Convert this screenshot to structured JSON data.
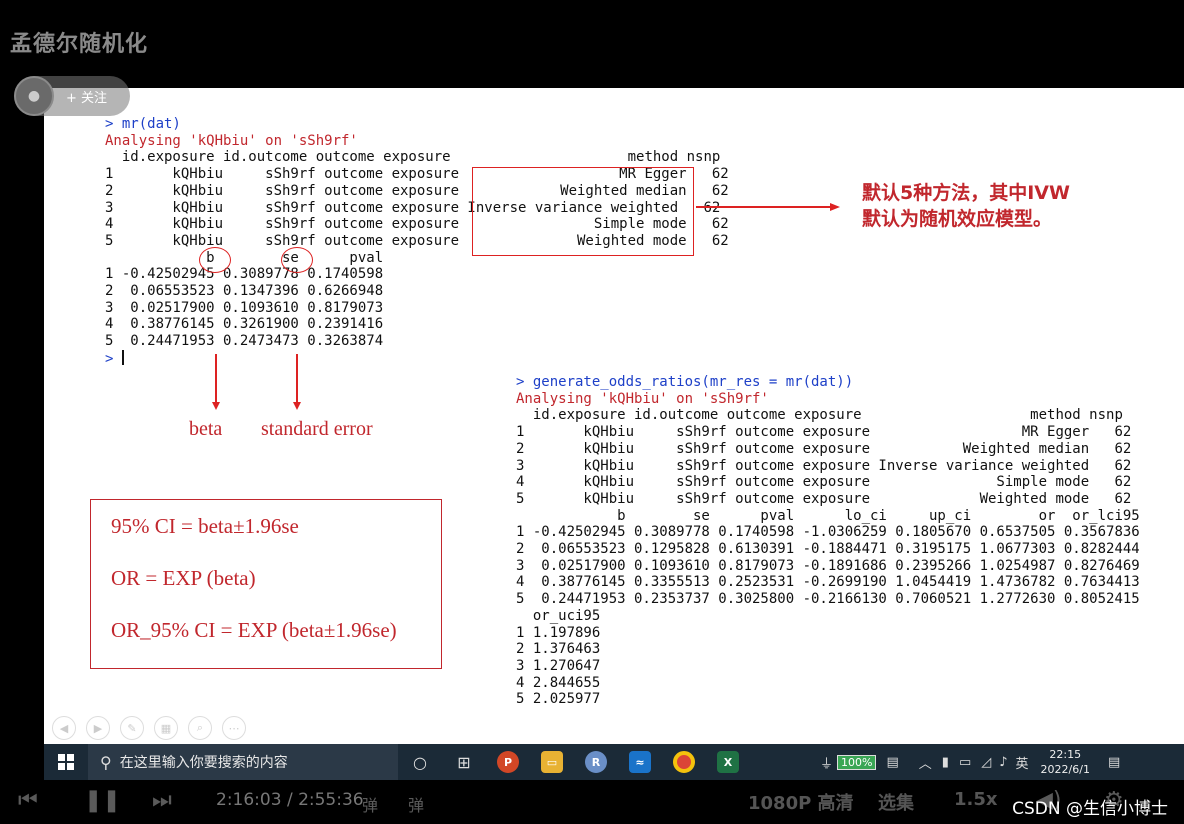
{
  "video": {
    "title": "孟德尔随机化",
    "follow_label": "+ 关注"
  },
  "console_a": {
    "lines": [
      {
        "t": "> mr(dat)",
        "c": "blue"
      },
      {
        "t": "Analysing 'kQHbiu' on 'sSh9rf'",
        "c": "red"
      },
      {
        "t": "  id.exposure id.outcome outcome exposure                     method nsnp",
        "c": "blk"
      },
      {
        "t": "1       kQHbiu     sSh9rf outcome exposure                   MR Egger   62",
        "c": "blk"
      },
      {
        "t": "2       kQHbiu     sSh9rf outcome exposure            Weighted median   62",
        "c": "blk"
      },
      {
        "t": "3       kQHbiu     sSh9rf outcome exposure Inverse variance weighted   62",
        "c": "blk"
      },
      {
        "t": "4       kQHbiu     sSh9rf outcome exposure                Simple mode   62",
        "c": "blk"
      },
      {
        "t": "5       kQHbiu     sSh9rf outcome exposure              Weighted mode   62",
        "c": "blk"
      },
      {
        "t": "            b        se      pval",
        "c": "blk"
      },
      {
        "t": "1 -0.42502945 0.3089778 0.1740598",
        "c": "blk"
      },
      {
        "t": "2  0.06553523 0.1347396 0.6266948",
        "c": "blk"
      },
      {
        "t": "3  0.02517900 0.1093610 0.8179073",
        "c": "blk"
      },
      {
        "t": "4  0.38776145 0.3261900 0.2391416",
        "c": "blk"
      },
      {
        "t": "5  0.24471953 0.2473473 0.3263874",
        "c": "blk"
      }
    ],
    "prompt": "> "
  },
  "console_b": {
    "lines": [
      {
        "t": "> generate_odds_ratios(mr_res = mr(dat))",
        "c": "blue"
      },
      {
        "t": "Analysing 'kQHbiu' on 'sSh9rf'",
        "c": "red"
      },
      {
        "t": "  id.exposure id.outcome outcome exposure                    method nsnp",
        "c": "blk"
      },
      {
        "t": "1       kQHbiu     sSh9rf outcome exposure                  MR Egger   62",
        "c": "blk"
      },
      {
        "t": "2       kQHbiu     sSh9rf outcome exposure           Weighted median   62",
        "c": "blk"
      },
      {
        "t": "3       kQHbiu     sSh9rf outcome exposure Inverse variance weighted   62",
        "c": "blk"
      },
      {
        "t": "4       kQHbiu     sSh9rf outcome exposure               Simple mode   62",
        "c": "blk"
      },
      {
        "t": "5       kQHbiu     sSh9rf outcome exposure             Weighted mode   62",
        "c": "blk"
      },
      {
        "t": "            b        se      pval      lo_ci     up_ci        or  or_lci95",
        "c": "blk"
      },
      {
        "t": "1 -0.42502945 0.3089778 0.1740598 -1.0306259 0.1805670 0.6537505 0.3567836",
        "c": "blk"
      },
      {
        "t": "2  0.06553523 0.1295828 0.6130391 -0.1884471 0.3195175 1.0677303 0.8282444",
        "c": "blk"
      },
      {
        "t": "3  0.02517900 0.1093610 0.8179073 -0.1891686 0.2395266 1.0254987 0.8276469",
        "c": "blk"
      },
      {
        "t": "4  0.38776145 0.3355513 0.2523531 -0.2699190 1.0454419 1.4736782 0.7634413",
        "c": "blk"
      },
      {
        "t": "5  0.24471953 0.2353737 0.3025800 -0.2166130 0.7060521 1.2772630 0.8052415",
        "c": "blk"
      },
      {
        "t": "  or_uci95",
        "c": "blk"
      },
      {
        "t": "1 1.197896",
        "c": "blk"
      },
      {
        "t": "2 1.376463",
        "c": "blk"
      },
      {
        "t": "3 1.270647",
        "c": "blk"
      },
      {
        "t": "4 2.844655",
        "c": "blk"
      },
      {
        "t": "5 2.025977",
        "c": "blk"
      }
    ]
  },
  "annotations": {
    "circle_b": "b",
    "circle_se": "se",
    "beta": "beta",
    "standard_error": "standard error",
    "note_line1": "默认5种方法，其中IVW",
    "note_line2": "默认为随机效应模型。"
  },
  "formulas": [
    "95% CI = beta±1.96se",
    "OR = EXP (beta)",
    "OR_95% CI = EXP (beta±1.96se)"
  ],
  "taskbar": {
    "search_placeholder": "在这里输入你要搜索的内容",
    "battery": "100%",
    "ime": "英",
    "time": "22:15",
    "date": "2022/6/1"
  },
  "player": {
    "time": "2:16:03 / 2:55:36",
    "quality": "1080P 高清",
    "episodes": "选集",
    "speed": "1.5x",
    "watermark": "CSDN @生信小博士"
  },
  "colors": {
    "annotation_red": "#c1272d",
    "console_blue": "#1e40c8",
    "taskbar": "#1b2a37"
  }
}
